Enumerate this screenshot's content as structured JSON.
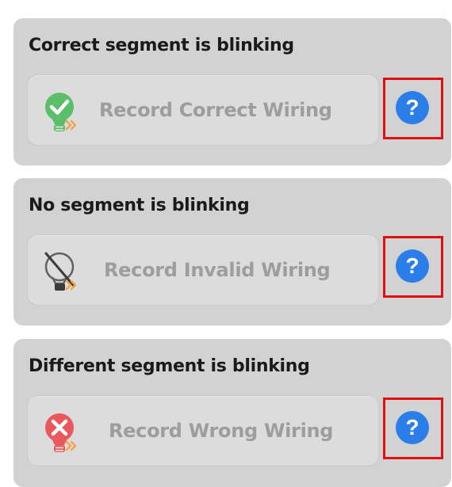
{
  "panels": [
    {
      "title": "Correct segment is blinking",
      "button_label": "Record Correct Wiring",
      "icon": "lightbulb-check-icon",
      "help_icon": "help-icon"
    },
    {
      "title": "No segment is blinking",
      "button_label": "Record Invalid Wiring",
      "icon": "lightbulb-off-icon",
      "help_icon": "help-icon"
    },
    {
      "title": "Different segment is blinking",
      "button_label": "Record Wrong Wiring",
      "icon": "lightbulb-error-icon",
      "help_icon": "help-icon"
    }
  ],
  "colors": {
    "panel_bg": "#d2d2d2",
    "button_bg": "#dcdcdc",
    "disabled_text": "#9d9d9d",
    "help_blue": "#2b7de9",
    "highlight_red": "#e01010",
    "success_green": "#5bbf6a",
    "error_red": "#e8585c",
    "arrow_orange": "#f2a44a"
  }
}
